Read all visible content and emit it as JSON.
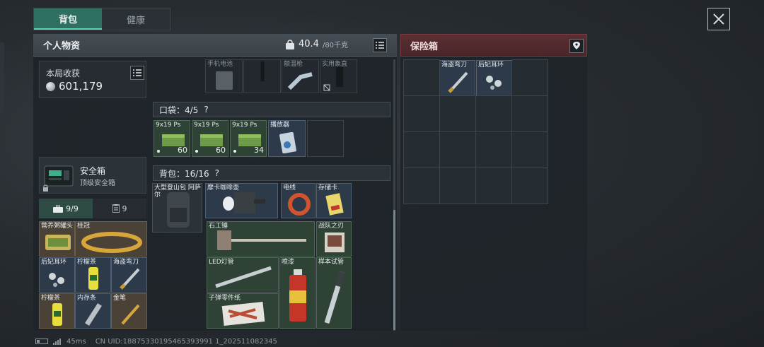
{
  "tabs": {
    "backpack": "背包",
    "health": "健康"
  },
  "personal": {
    "title": "个人物资",
    "weight": "40.4",
    "weight_max": "/80千克"
  },
  "loot": {
    "label": "本局收获",
    "value": "601,179"
  },
  "safe_case": {
    "name": "安全箱",
    "sub": "顶级安全箱"
  },
  "left_tabs": {
    "tab1_count": "9/9",
    "tab2_count": "9"
  },
  "left_items": [
    {
      "name": "营养粥罐头"
    },
    {
      "name": "桂冠"
    },
    {
      "name": "后妃耳环"
    },
    {
      "name": "柠檬茶"
    },
    {
      "name": "海盗弯刀"
    },
    {
      "name": "柠檬茶"
    },
    {
      "name": "内存条"
    },
    {
      "name": "金笔"
    }
  ],
  "top_items": [
    {
      "name": "手机电池"
    },
    {
      "name": ""
    },
    {
      "name": "额温枪"
    },
    {
      "name": "实用象直"
    }
  ],
  "pocket": {
    "label": "口袋：4/5",
    "help": "?"
  },
  "pocket_items": [
    {
      "name": "9x19 Ps",
      "count": "60"
    },
    {
      "name": "9x19 Ps",
      "count": "60"
    },
    {
      "name": "9x19 Ps",
      "count": "34"
    },
    {
      "name": "播放器",
      "count": ""
    }
  ],
  "backpack": {
    "label": "背包：16/16",
    "help": "?"
  },
  "backpack_item": {
    "name": "大型登山包 阿萨尔"
  },
  "bag_items": [
    {
      "name": "摩卡咖啡壶"
    },
    {
      "name": "电线"
    },
    {
      "name": "存储卡"
    },
    {
      "name": "石工锤"
    },
    {
      "name": "战队之刃"
    },
    {
      "name": "LED灯管"
    },
    {
      "name": "喷漆"
    },
    {
      "name": "样本试管"
    },
    {
      "name": "子弹零件纸"
    }
  ],
  "safe_panel": {
    "title": "保险箱",
    "items": [
      {
        "name": "海盗弯刀"
      },
      {
        "name": "后妃耳环"
      }
    ]
  },
  "footer": {
    "ping": "45ms",
    "uid": "CN UID:18875330195465393991 1_202511082345"
  },
  "colors": {
    "accent_green": "#2f6f62",
    "safe_red": "#5a2f33"
  }
}
